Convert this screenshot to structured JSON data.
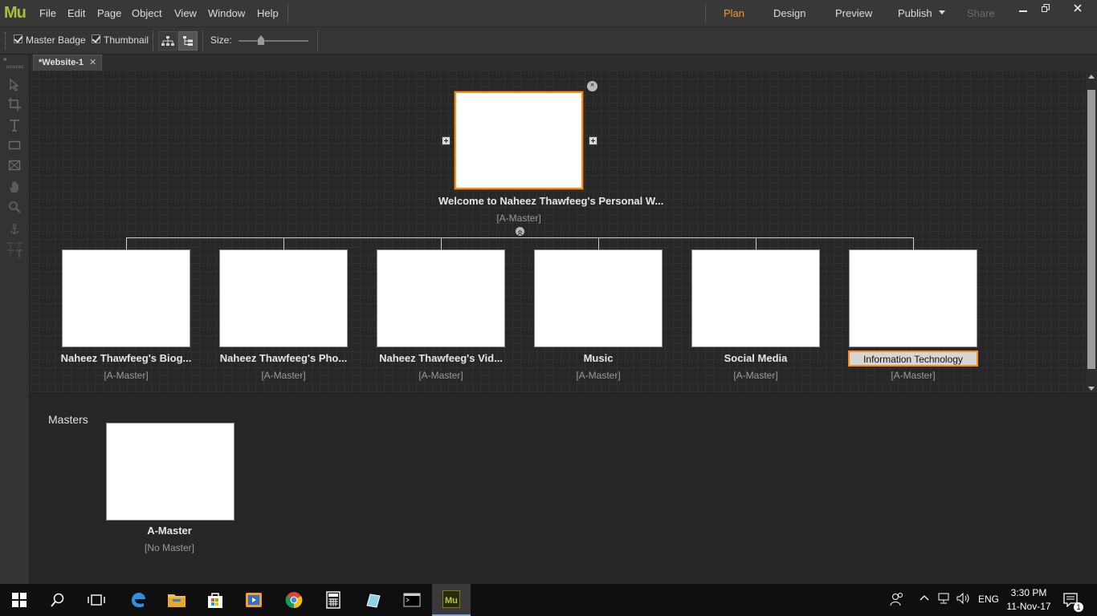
{
  "app": {
    "logo": "Mu",
    "menus": [
      "File",
      "Edit",
      "Page",
      "Object",
      "View",
      "Window",
      "Help"
    ],
    "modes": [
      "Plan",
      "Design",
      "Preview",
      "Publish",
      "Share"
    ],
    "active_mode": "Plan",
    "accent_color": "#f29b22"
  },
  "controlbar": {
    "master_badge_label": "Master Badge",
    "master_badge_checked": true,
    "thumbnail_label": "Thumbnail",
    "thumbnail_checked": true,
    "size_label": "Size:"
  },
  "document": {
    "tab_title": "*Website-1"
  },
  "sitemap": {
    "home": {
      "title": "Welcome to Naheez Thawfeeg's Personal W...",
      "master": "[A-Master]"
    },
    "children": [
      {
        "title": "Naheez Thawfeeg's Biog...",
        "master": "[A-Master]"
      },
      {
        "title": "Naheez Thawfeeg's Pho...",
        "master": "[A-Master]"
      },
      {
        "title": "Naheez Thawfeeg's Vid...",
        "master": "[A-Master]"
      },
      {
        "title": "Music",
        "master": "[A-Master]"
      },
      {
        "title": "Social Media",
        "master": "[A-Master]"
      },
      {
        "title": "Information Technology",
        "master": "[A-Master]",
        "editing": true
      }
    ]
  },
  "masters": {
    "label": "Masters",
    "items": [
      {
        "title": "A-Master",
        "master": "[No Master]"
      }
    ]
  },
  "taskbar": {
    "language": "ENG",
    "time": "3:30 PM",
    "date": "11-Nov-17",
    "notification_count": "1"
  }
}
